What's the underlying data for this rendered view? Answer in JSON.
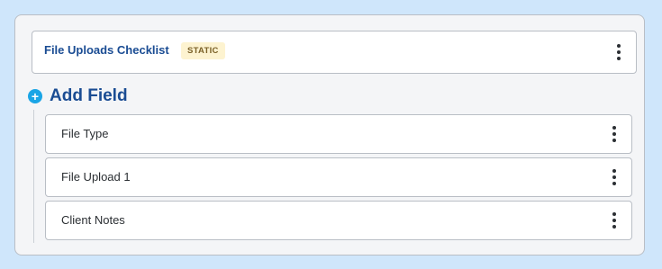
{
  "section": {
    "title": "File Uploads Checklist",
    "badge": "STATIC"
  },
  "add_field": {
    "label": "Add Field",
    "icon": "plus-circle-icon"
  },
  "fields": [
    {
      "label": "File Type"
    },
    {
      "label": "File Upload 1"
    },
    {
      "label": "Client Notes"
    }
  ],
  "colors": {
    "page_background": "#cfe6fb",
    "title_blue": "#1a4c93",
    "add_icon": "#1aa5e6",
    "badge_bg": "#fdf3d0"
  }
}
